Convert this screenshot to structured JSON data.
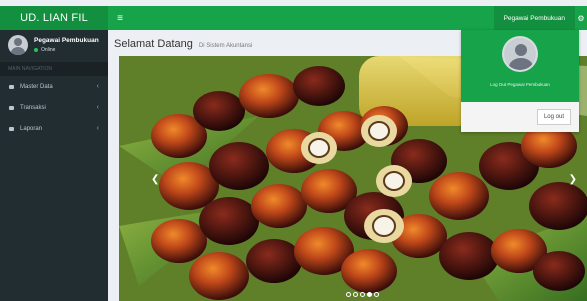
{
  "brand": "UD. LIAN FIL",
  "header": {
    "user_label": "Pegawai Pembukuan"
  },
  "sidebar": {
    "user": {
      "name": "Pegawai Pembukuan",
      "status": "Online"
    },
    "nav_header": "MAIN NAVIGATION",
    "items": [
      {
        "label": "Master Data"
      },
      {
        "label": "Transaksi"
      },
      {
        "label": "Laporan"
      }
    ]
  },
  "main": {
    "title": "Selamat Datang",
    "subtitle": "Di Sistem Akuntansi",
    "carousel": {
      "slides": 5,
      "active_index": 3
    }
  },
  "dropdown": {
    "caption": "Log Out Pegawai Pembukuan",
    "logout_label": "Log out"
  },
  "colors": {
    "accent": "#16a34a",
    "accent_dark": "#13903f",
    "sidebar_bg": "#222d32"
  }
}
